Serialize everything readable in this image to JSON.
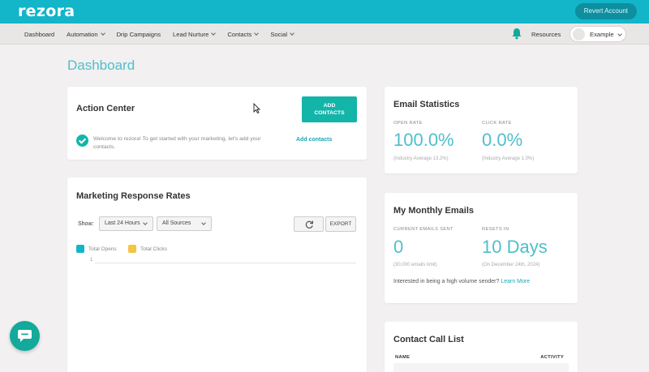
{
  "app": {
    "logo": "rezora"
  },
  "topbar": {
    "revert_label": "Revert Account"
  },
  "nav": {
    "items": [
      {
        "label": "Dashboard",
        "has_dropdown": false
      },
      {
        "label": "Automation",
        "has_dropdown": true
      },
      {
        "label": "Drip Campaigns",
        "has_dropdown": false
      },
      {
        "label": "Lead Nurture",
        "has_dropdown": true
      },
      {
        "label": "Contacts",
        "has_dropdown": true
      },
      {
        "label": "Social",
        "has_dropdown": true
      }
    ],
    "resources_label": "Resources",
    "user_name": "Example"
  },
  "page": {
    "title": "Dashboard"
  },
  "action_center": {
    "title": "Action Center",
    "add_button_line1": "ADD",
    "add_button_line2": "CONTACTS",
    "welcome_text": "Welcome to rezora! To get started with your marketing, let's add your contacts.",
    "add_link": "Add contacts"
  },
  "response_rates": {
    "title": "Marketing Response Rates",
    "show_label": "Show:",
    "range_value": "Last 24 Hours",
    "source_value": "All Sources",
    "export_label": "EXPORT",
    "legend": [
      {
        "label": "Total Opens",
        "color": "#13b5c9"
      },
      {
        "label": "Total Clicks",
        "color": "#f5c445"
      }
    ],
    "y_tick": "1"
  },
  "email_stats": {
    "title": "Email Statistics",
    "open_label": "OPEN RATE",
    "open_value": "100.0%",
    "open_sub": "(Industry Average 13.2%)",
    "click_label": "CLICK RATE",
    "click_value": "0.0%",
    "click_sub": "(Industry Average 1.0%)"
  },
  "monthly_emails": {
    "title": "My Monthly Emails",
    "sent_label": "CURRENT EMAILS SENT",
    "sent_value": "0",
    "sent_sub": "(30,000 emails limit)",
    "resets_label": "RESETS IN",
    "resets_value": "10 Days",
    "resets_sub": "(On December 24th, 2024)",
    "high_volume_text": "Interested in being a high volume sender?",
    "learn_more": "Learn More"
  },
  "call_list": {
    "title": "Contact Call List",
    "col_name": "NAME",
    "col_activity": "ACTIVITY"
  },
  "colors": {
    "brand": "#13b5c9",
    "accent": "#13b5a9",
    "link": "#1aa8b8"
  }
}
